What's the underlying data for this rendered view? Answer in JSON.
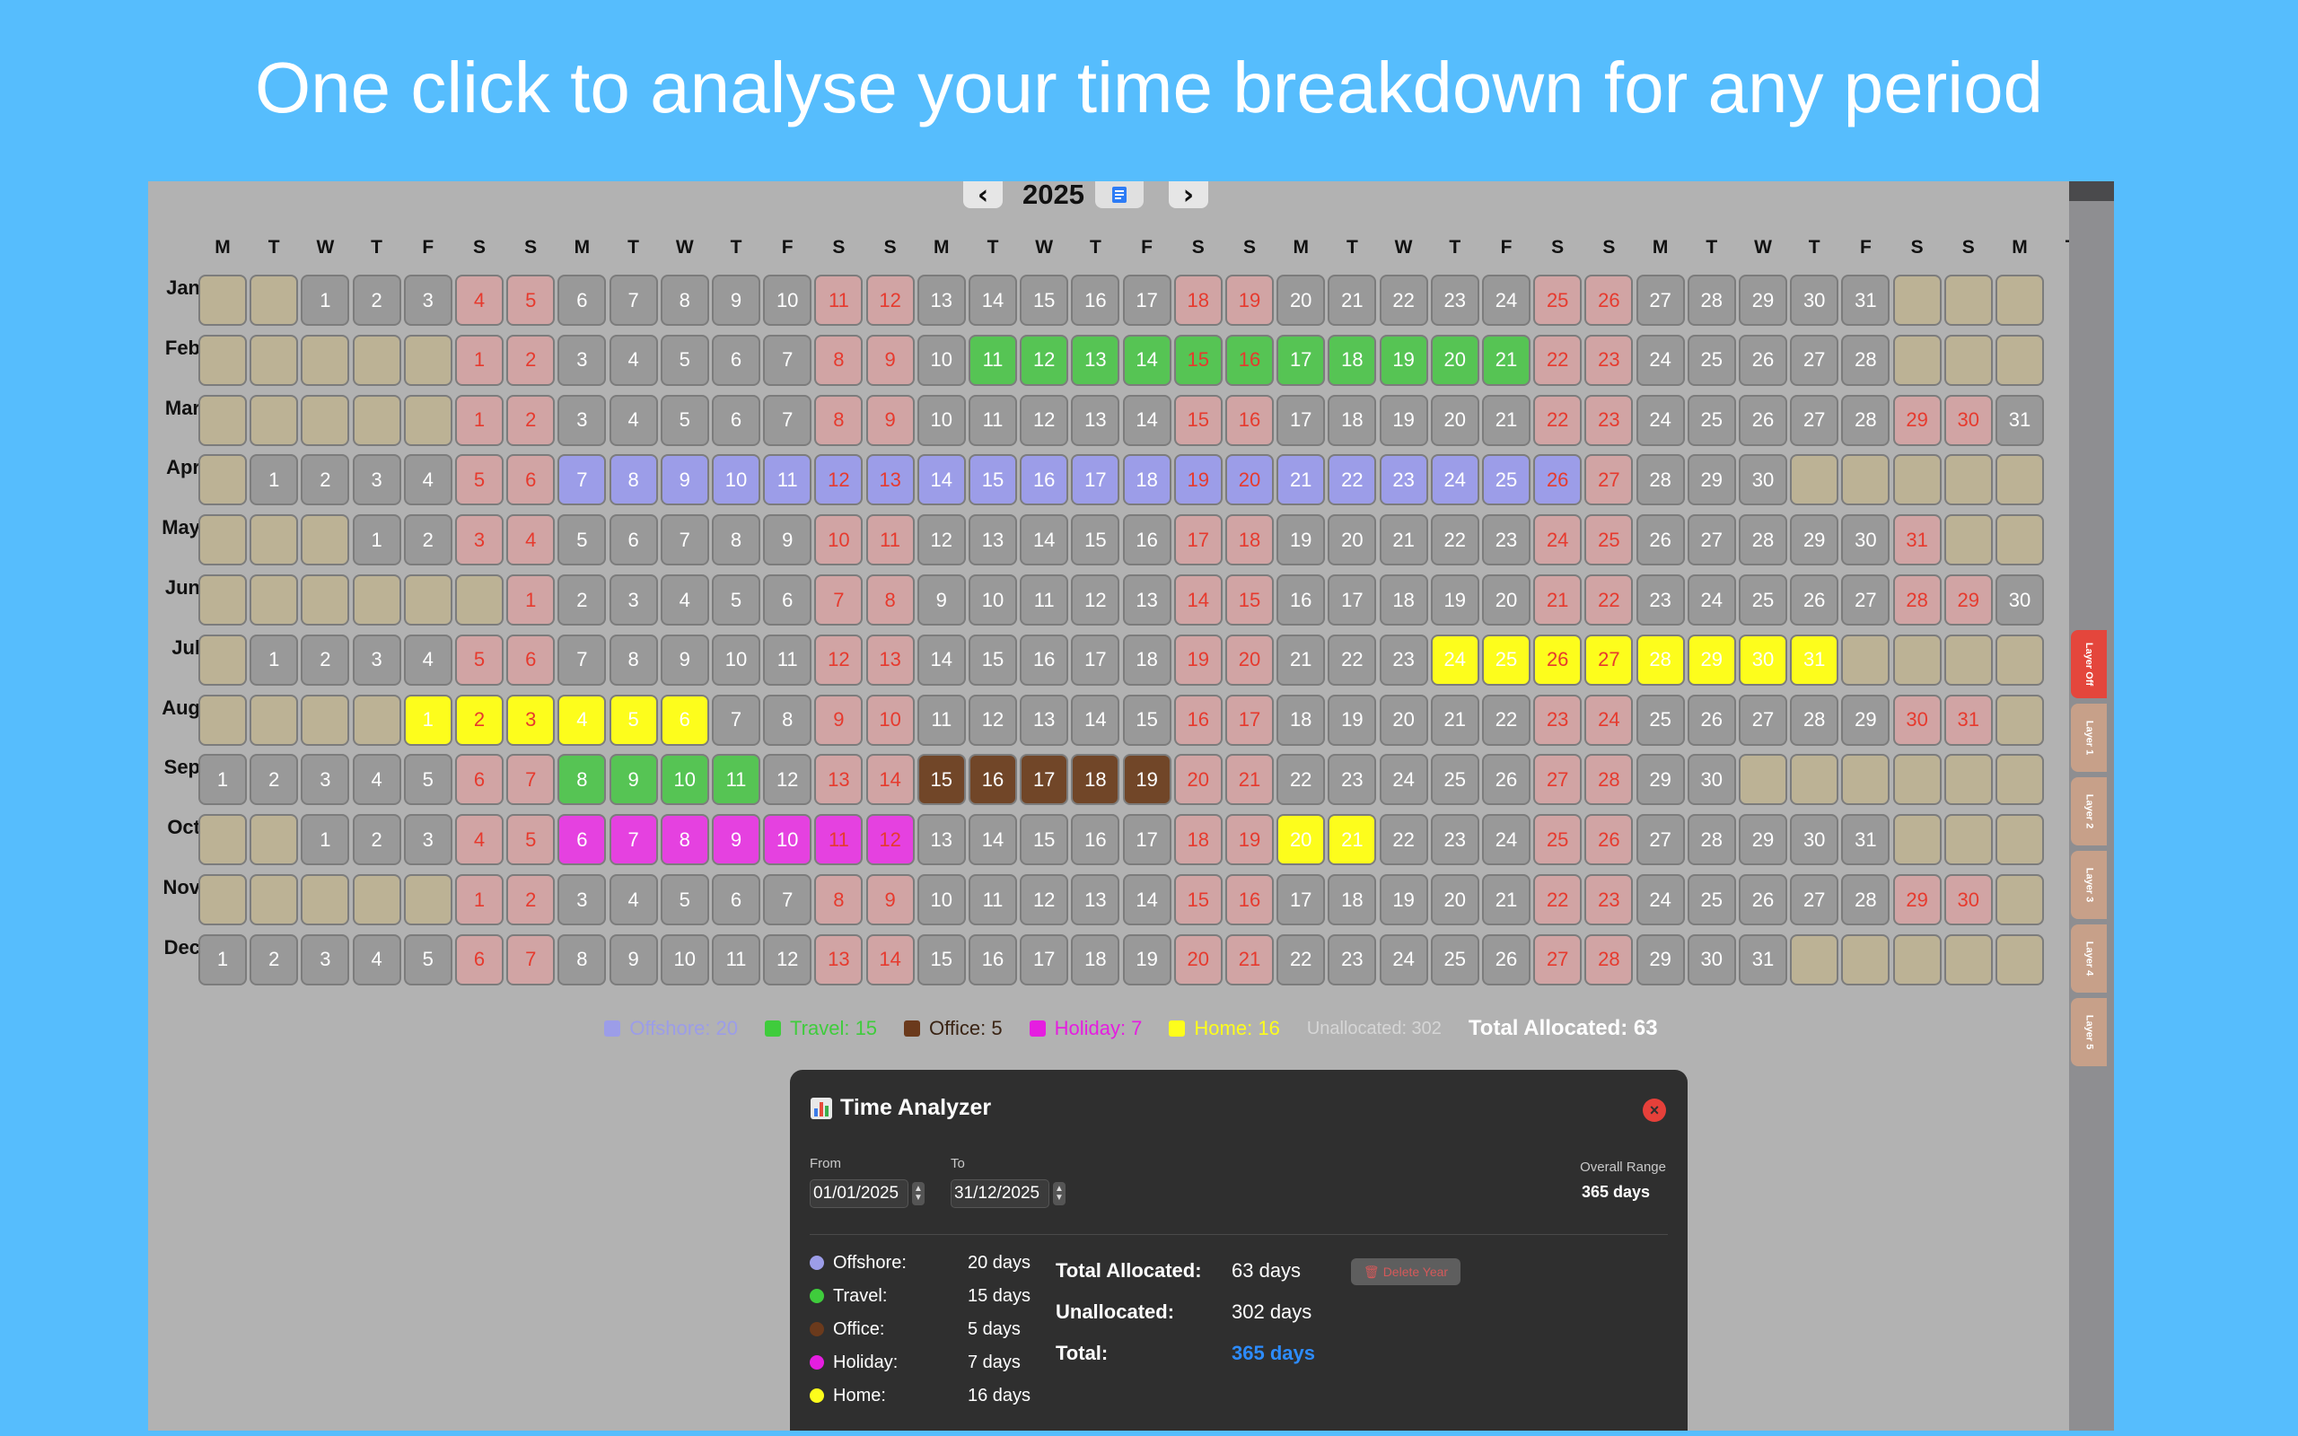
{
  "headline": "One click to analyse your time breakdown for any period",
  "nav": {
    "prev_icon": "chevron-left-icon",
    "year": "2025",
    "doc_icon": "document-icon",
    "next_icon": "chevron-right-icon",
    "prev_glyph": "‹",
    "next_glyph": "›"
  },
  "weekday_headers": [
    "M",
    "T",
    "W",
    "T",
    "F",
    "S",
    "S",
    "M",
    "T",
    "W",
    "T",
    "F",
    "S",
    "S",
    "M",
    "T",
    "W",
    "T",
    "F",
    "S",
    "S",
    "M",
    "T",
    "W",
    "T",
    "F",
    "S",
    "S",
    "M",
    "T",
    "W",
    "T",
    "F",
    "S",
    "S",
    "M",
    "T",
    "W",
    "T",
    "F",
    "S",
    "S",
    "M"
  ],
  "months": [
    {
      "label": "Jan",
      "offset": 2,
      "days": 31,
      "allocations": {}
    },
    {
      "label": "Feb",
      "offset": 5,
      "days": 28,
      "allocations": {
        "11": "tra",
        "12": "tra",
        "13": "tra",
        "14": "tra",
        "15": "tra",
        "16": "tra",
        "17": "tra",
        "18": "tra",
        "19": "tra",
        "20": "tra",
        "21": "tra"
      }
    },
    {
      "label": "Mar",
      "offset": 5,
      "days": 31,
      "allocations": {}
    },
    {
      "label": "Apr",
      "offset": 1,
      "days": 30,
      "allocations": {
        "7": "off",
        "8": "off",
        "9": "off",
        "10": "off",
        "11": "off",
        "12": "off",
        "13": "off",
        "14": "off",
        "15": "off",
        "16": "off",
        "17": "off",
        "18": "off",
        "19": "off",
        "20": "off",
        "21": "off",
        "22": "off",
        "23": "off",
        "24": "off",
        "25": "off",
        "26": "off"
      }
    },
    {
      "label": "May",
      "offset": 3,
      "days": 31,
      "allocations": {}
    },
    {
      "label": "Jun",
      "offset": 6,
      "days": 30,
      "allocations": {}
    },
    {
      "label": "Jul",
      "offset": 1,
      "days": 31,
      "allocations": {
        "24": "hom",
        "25": "hom",
        "26": "hom",
        "27": "hom",
        "28": "hom",
        "29": "hom",
        "30": "hom",
        "31": "hom"
      }
    },
    {
      "label": "Aug",
      "offset": 4,
      "days": 31,
      "allocations": {
        "1": "hom",
        "2": "hom",
        "3": "hom",
        "4": "hom",
        "5": "hom",
        "6": "hom"
      }
    },
    {
      "label": "Sep",
      "offset": 0,
      "days": 30,
      "allocations": {
        "8": "tra",
        "9": "tra",
        "10": "tra",
        "11": "tra",
        "15": "ofc",
        "16": "ofc",
        "17": "ofc",
        "18": "ofc",
        "19": "ofc"
      }
    },
    {
      "label": "Oct",
      "offset": 2,
      "days": 31,
      "allocations": {
        "6": "hol",
        "7": "hol",
        "8": "hol",
        "9": "hol",
        "10": "hol",
        "11": "hol",
        "12": "hol",
        "20": "hom",
        "21": "hom"
      }
    },
    {
      "label": "Nov",
      "offset": 5,
      "days": 30,
      "allocations": {}
    },
    {
      "label": "Dec",
      "offset": 0,
      "days": 31,
      "allocations": {}
    }
  ],
  "legend": {
    "items": [
      {
        "label": "Offshore: 20",
        "color": "#9c9de8",
        "text_color": "#9c9de8"
      },
      {
        "label": "Travel: 15",
        "color": "#3fcc3c",
        "text_color": "#3fcc3c"
      },
      {
        "label": "Office: 5",
        "color": "#6b3a1c",
        "text_color": "#3a2414"
      },
      {
        "label": "Holiday: 7",
        "color": "#e51ee0",
        "text_color": "#e51ee0"
      },
      {
        "label": "Home: 16",
        "color": "#fdfd1c",
        "text_color": "#fdfd1c"
      }
    ],
    "unallocated": "Unallocated: 302",
    "total": "Total Allocated: 63"
  },
  "layers": [
    "Layer Off",
    "Layer 1",
    "Layer 2",
    "Layer 3",
    "Layer 4",
    "Layer 5"
  ],
  "analyzer": {
    "icon": "chart-icon",
    "title": "Time Analyzer",
    "from_label": "From",
    "from_value": "01/01/2025",
    "to_label": "To",
    "to_value": "31/12/2025",
    "range_label": "Overall Range",
    "range_value": "365 days",
    "categories": [
      {
        "name": "Offshore:",
        "value": "20 days",
        "color": "#9c9de8"
      },
      {
        "name": "Travel:",
        "value": "15 days",
        "color": "#3fcc3c"
      },
      {
        "name": "Office:",
        "value": "5 days",
        "color": "#6b3a1c"
      },
      {
        "name": "Holiday:",
        "value": "7 days",
        "color": "#e51ee0"
      },
      {
        "name": "Home:",
        "value": "16 days",
        "color": "#fdfd1c"
      }
    ],
    "total_allocated_label": "Total Allocated:",
    "total_allocated_value": "63 days",
    "unallocated_label": "Unallocated:",
    "unallocated_value": "302 days",
    "total_label": "Total:",
    "total_value": "365 days",
    "delete_label": "Delete Year"
  }
}
